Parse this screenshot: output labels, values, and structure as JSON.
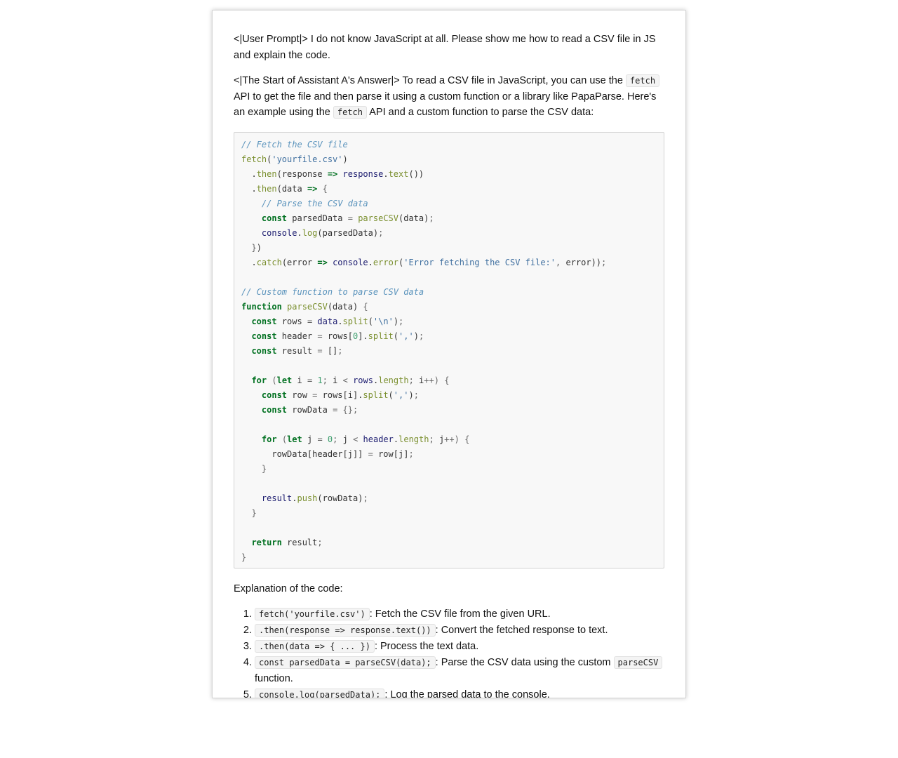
{
  "prompt": {
    "tag": "<|User Prompt|>",
    "text": " I do not know JavaScript at all. Please show me how to read a CSV file in JS and explain the code."
  },
  "answer_intro": {
    "tag": "<|The Start of Assistant A's Answer|>",
    "part1": " To read a CSV file in JavaScript, you can use the ",
    "code1": "fetch",
    "part2": " API to get the file and then parse it using a custom function or a library like PapaParse. Here's an example using the ",
    "code2": "fetch",
    "part3": " API and a custom function to parse the CSV data:"
  },
  "code_lines": {
    "c1": "// Fetch the CSV file",
    "c2": "// Parse the CSV data",
    "c3": "// Custom function to parse CSV data",
    "file": "'yourfile.csv'",
    "err_msg": "'Error fetching the CSV file:'",
    "newline": "'\\n'",
    "comma": "','"
  },
  "explanation_heading": "Explanation of the code:",
  "steps": [
    {
      "code": "fetch('yourfile.csv')",
      "text": ": Fetch the CSV file from the given URL."
    },
    {
      "code": ".then(response => response.text())",
      "text": ": Convert the fetched response to text."
    },
    {
      "code": ".then(data => { ... })",
      "text": ": Process the text data."
    },
    {
      "code": "const parsedData = parseCSV(data);",
      "text": ": Parse the CSV data using the custom ",
      "code2": "parseCSV",
      "text2": " function."
    },
    {
      "code": "console.log(parsedData);",
      "text": ": Log the parsed data to the console."
    }
  ]
}
